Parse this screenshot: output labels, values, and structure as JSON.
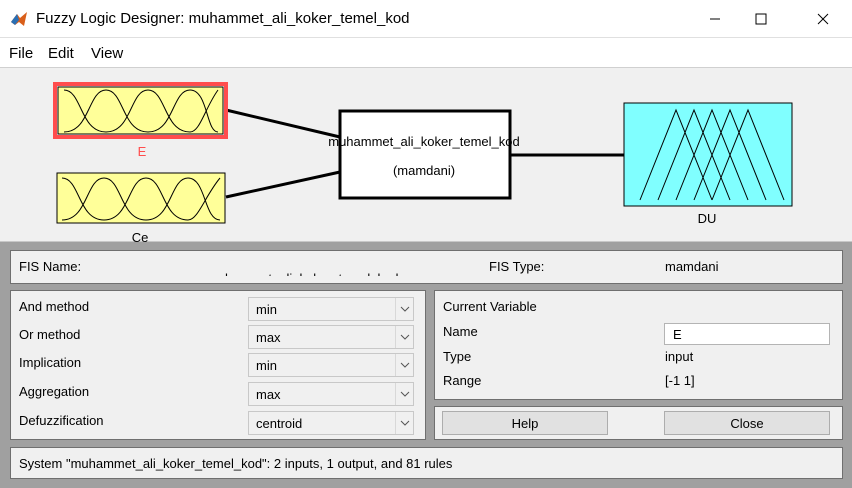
{
  "window": {
    "title": "Fuzzy Logic Designer: muhammet_ali_koker_temel_kod",
    "app_icon": "matlab-logo-icon"
  },
  "menu": {
    "file": "File",
    "edit": "Edit",
    "view": "View"
  },
  "diagram": {
    "inputs": [
      {
        "name": "E",
        "selected": true
      },
      {
        "name": "Ce",
        "selected": false
      }
    ],
    "system_name": "muhammet_ali_koker_temel_kod",
    "system_type": "(mamdani)",
    "output": {
      "name": "DU"
    },
    "colors": {
      "input_fill": "#ffff99",
      "output_fill": "#80ffff",
      "selection": "#ff4d4d",
      "selected_label": "#ff4d4d"
    }
  },
  "fis": {
    "name_label": "FIS Name:",
    "name_value": "muhammet_ali_koker_temel_kod",
    "type_label": "FIS Type:",
    "type_value": "mamdani"
  },
  "methods": {
    "and": {
      "label": "And method",
      "value": "min"
    },
    "or": {
      "label": "Or method",
      "value": "max"
    },
    "implication": {
      "label": "Implication",
      "value": "min"
    },
    "aggregation": {
      "label": "Aggregation",
      "value": "max"
    },
    "defuzz": {
      "label": "Defuzzification",
      "value": "centroid"
    }
  },
  "current_variable": {
    "header": "Current Variable",
    "name_label": "Name",
    "name_value": "E",
    "type_label": "Type",
    "type_value": "input",
    "range_label": "Range",
    "range_value": "[-1 1]"
  },
  "buttons": {
    "help": "Help",
    "close": "Close"
  },
  "status": "System \"muhammet_ali_koker_temel_kod\": 2 inputs, 1 output, and 81 rules"
}
